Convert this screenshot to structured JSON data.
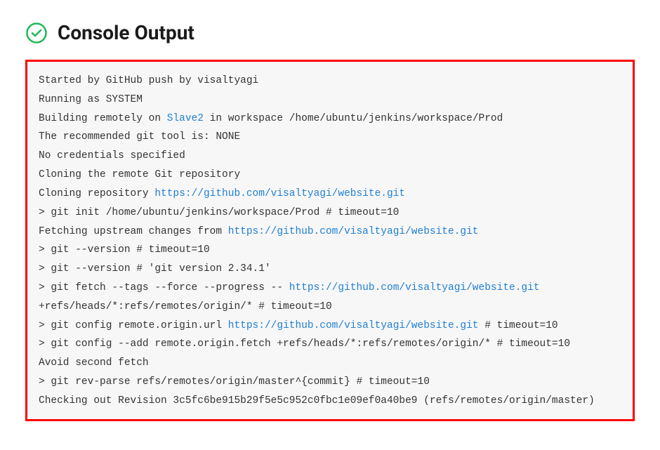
{
  "header": {
    "title": "Console Output",
    "status_icon": "check-circle-icon",
    "status_color": "#1db954"
  },
  "console": {
    "border_color": "#ff0000",
    "lines": [
      {
        "segments": [
          {
            "text": "Started by GitHub push by visaltyagi"
          }
        ]
      },
      {
        "segments": [
          {
            "text": "Running as SYSTEM"
          }
        ]
      },
      {
        "segments": [
          {
            "text": "Building remotely on "
          },
          {
            "text": "Slave2",
            "link": true
          },
          {
            "text": " in workspace /home/ubuntu/jenkins/workspace/Prod"
          }
        ]
      },
      {
        "segments": [
          {
            "text": "The recommended git tool is: NONE"
          }
        ]
      },
      {
        "segments": [
          {
            "text": "No credentials specified"
          }
        ]
      },
      {
        "segments": [
          {
            "text": "Cloning the remote Git repository"
          }
        ]
      },
      {
        "segments": [
          {
            "text": "Cloning repository "
          },
          {
            "text": "https://github.com/visaltyagi/website.git",
            "link": true
          }
        ]
      },
      {
        "segments": [
          {
            "text": " > git init /home/ubuntu/jenkins/workspace/Prod # timeout=10"
          }
        ]
      },
      {
        "segments": [
          {
            "text": "Fetching upstream changes from "
          },
          {
            "text": "https://github.com/visaltyagi/website.git",
            "link": true
          }
        ]
      },
      {
        "segments": [
          {
            "text": " > git --version # timeout=10"
          }
        ]
      },
      {
        "segments": [
          {
            "text": " > git --version # 'git version 2.34.1'"
          }
        ]
      },
      {
        "segments": [
          {
            "text": " > git fetch --tags --force --progress -- "
          },
          {
            "text": "https://github.com/visaltyagi/website.git",
            "link": true
          },
          {
            "text": " +refs/heads/*:refs/remotes/origin/* # timeout=10"
          }
        ]
      },
      {
        "segments": [
          {
            "text": " > git config remote.origin.url "
          },
          {
            "text": "https://github.com/visaltyagi/website.git",
            "link": true
          },
          {
            "text": " # timeout=10"
          }
        ]
      },
      {
        "segments": [
          {
            "text": " > git config --add remote.origin.fetch +refs/heads/*:refs/remotes/origin/* # timeout=10"
          }
        ]
      },
      {
        "segments": [
          {
            "text": "Avoid second fetch"
          }
        ]
      },
      {
        "segments": [
          {
            "text": " > git rev-parse refs/remotes/origin/master^{commit} # timeout=10"
          }
        ]
      },
      {
        "segments": [
          {
            "text": "Checking out Revision 3c5fc6be915b29f5e5c952c0fbc1e09ef0a40be9 (refs/remotes/origin/master)"
          }
        ]
      }
    ]
  }
}
